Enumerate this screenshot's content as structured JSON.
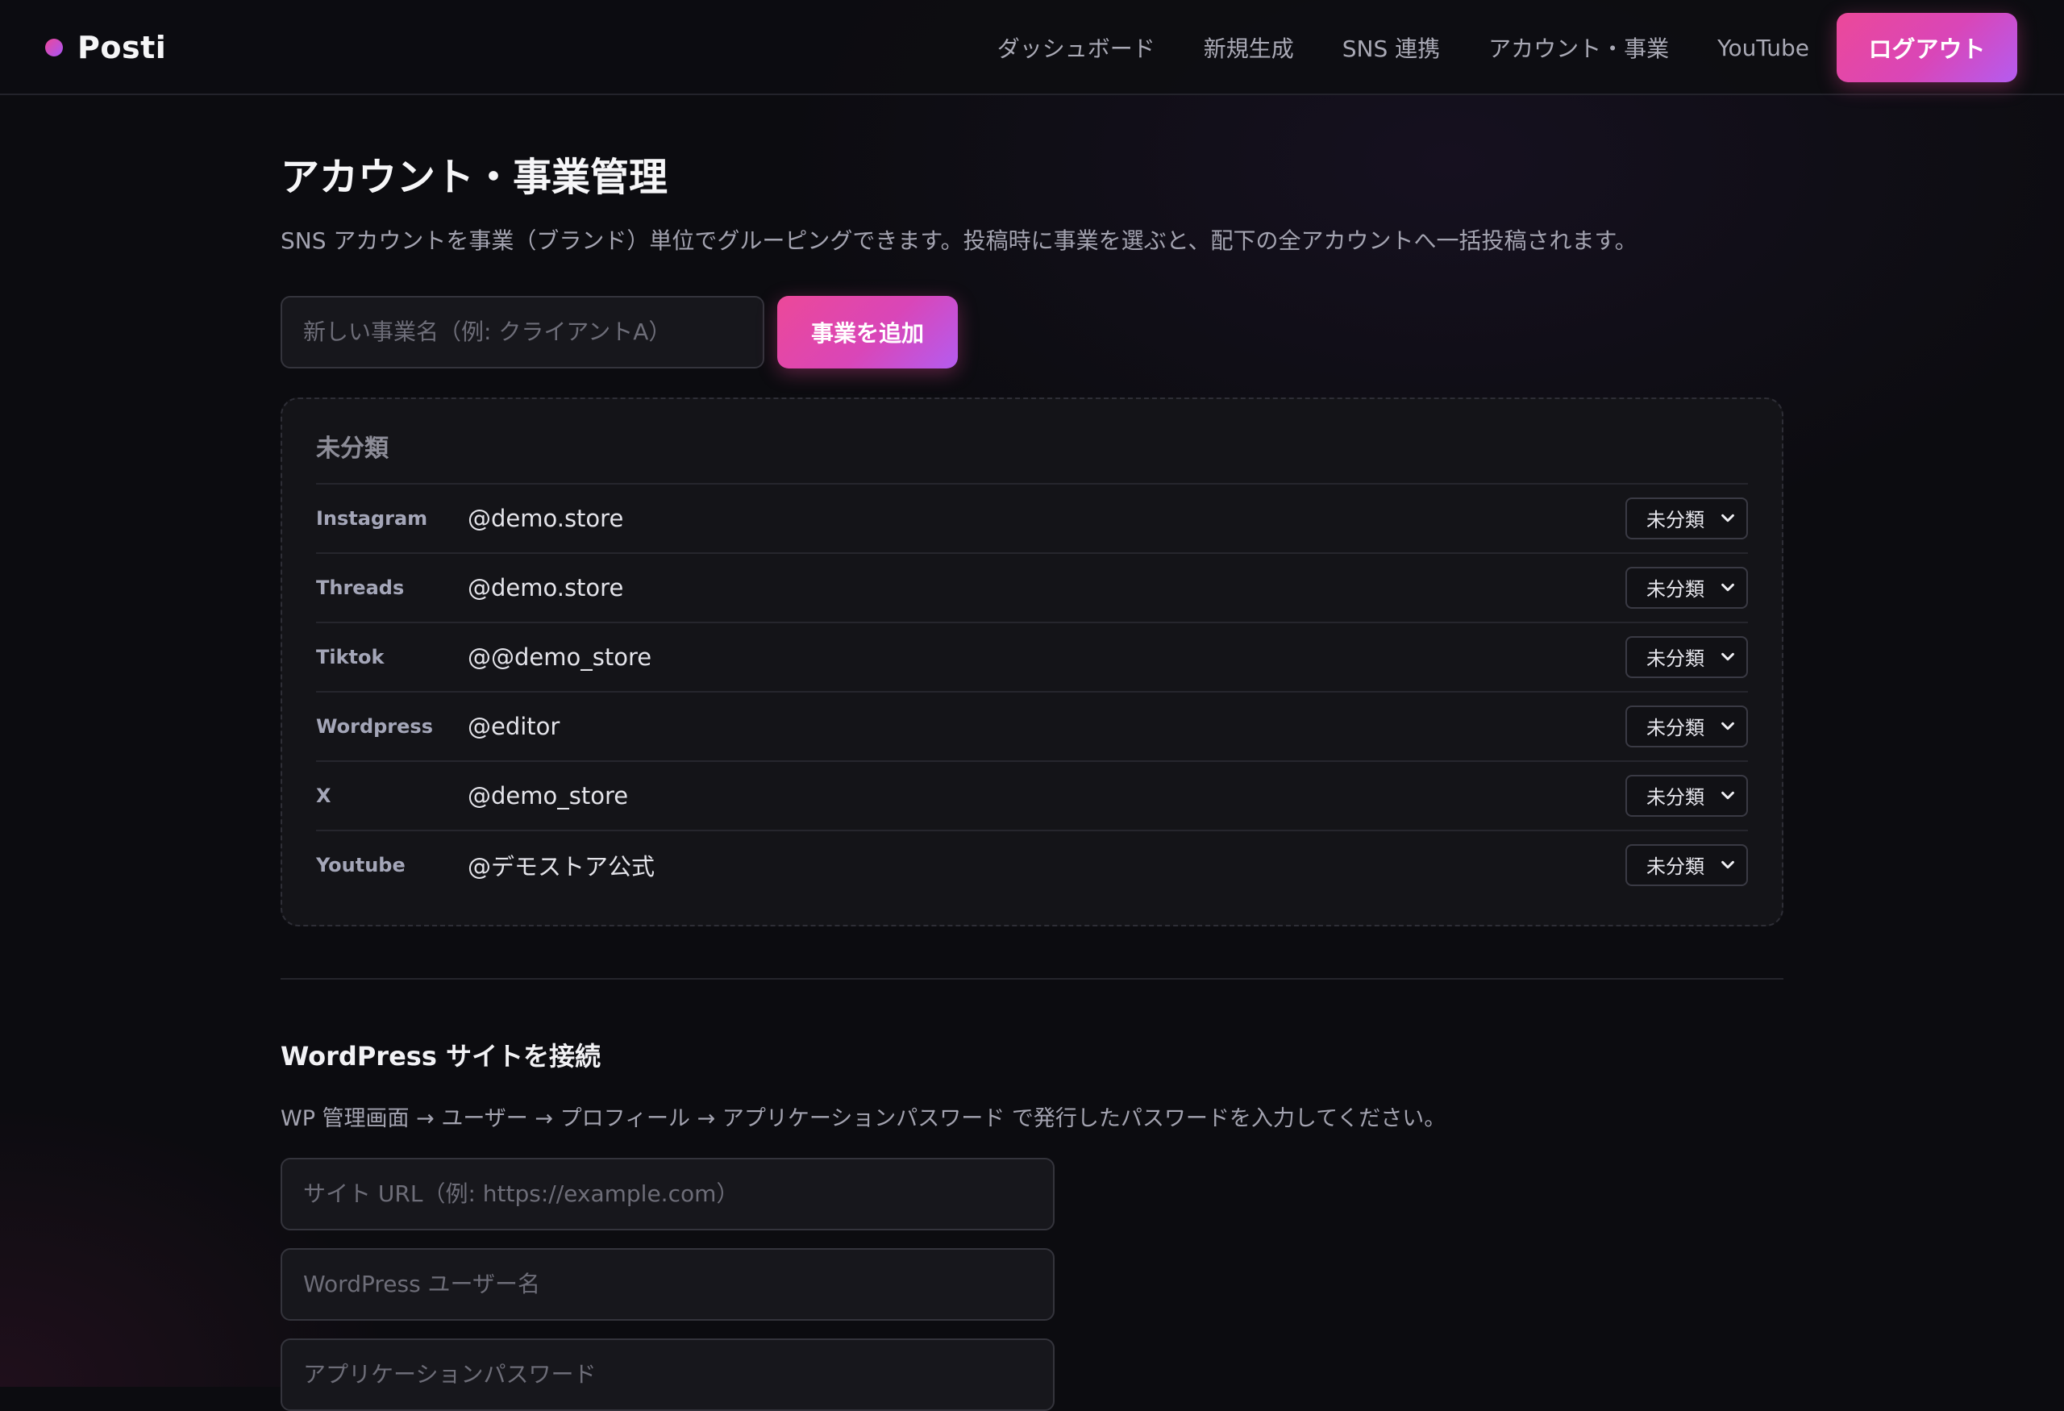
{
  "brand": {
    "name": "Posti",
    "accent_from": "#ec4899",
    "accent_to": "#a855f7"
  },
  "nav": {
    "items": [
      {
        "label": "ダッシュボード"
      },
      {
        "label": "新規生成"
      },
      {
        "label": "SNS 連携"
      },
      {
        "label": "アカウント・事業"
      },
      {
        "label": "YouTube"
      }
    ],
    "logout_label": "ログアウト"
  },
  "page": {
    "title": "アカウント・事業管理",
    "description": "SNS アカウントを事業（ブランド）単位でグルーピングできます。投稿時に事業を選ぶと、配下の全アカウントへ一括投稿されます。"
  },
  "add_business": {
    "placeholder": "新しい事業名（例: クライアントA）",
    "button_label": "事業を追加"
  },
  "group": {
    "title": "未分類",
    "accounts": [
      {
        "platform": "Instagram",
        "handle": "@demo.store",
        "selected": "未分類"
      },
      {
        "platform": "Threads",
        "handle": "@demo.store",
        "selected": "未分類"
      },
      {
        "platform": "Tiktok",
        "handle": "@@demo_store",
        "selected": "未分類"
      },
      {
        "platform": "Wordpress",
        "handle": "@editor",
        "selected": "未分類"
      },
      {
        "platform": "X",
        "handle": "@demo_store",
        "selected": "未分類"
      },
      {
        "platform": "Youtube",
        "handle": "@デモストア公式",
        "selected": "未分類"
      }
    ]
  },
  "wordpress": {
    "title": "WordPress サイトを接続",
    "description": "WP 管理画面 → ユーザー → プロフィール → アプリケーションパスワード で発行したパスワードを入力してください。",
    "site_url_placeholder": "サイト URL（例: https://example.com）",
    "username_placeholder": "WordPress ユーザー名",
    "app_password_placeholder": "アプリケーションパスワード"
  }
}
